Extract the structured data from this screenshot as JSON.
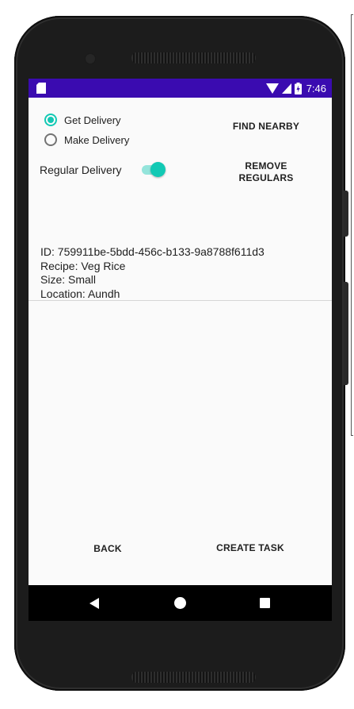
{
  "status_bar": {
    "time": "7:46",
    "background": "#3a0bb0",
    "icons": [
      "sd-card-icon",
      "wifi-icon",
      "cell-signal-icon",
      "battery-charging-icon"
    ]
  },
  "delivery_mode": {
    "options": [
      {
        "label": "Get Delivery",
        "checked": true
      },
      {
        "label": "Make Delivery",
        "checked": false
      }
    ]
  },
  "buttons": {
    "find_nearby": "FIND NEARBY",
    "remove_regulars_line1": "REMOVE",
    "remove_regulars_line2": "REGULARS",
    "back": "BACK",
    "create_task": "CREATE TASK"
  },
  "regular_delivery": {
    "label": "Regular Delivery",
    "enabled": true
  },
  "delivery_info": {
    "id": "ID: 759911be-5bdd-456c-b133-9a8788f611d3",
    "recipe": "Recipe: Veg Rice",
    "size": "Size: Small",
    "location": "Location: Aundh"
  },
  "colors": {
    "accent": "#12c9b4",
    "status_bar": "#3a0bb0",
    "background": "#fafafa"
  }
}
